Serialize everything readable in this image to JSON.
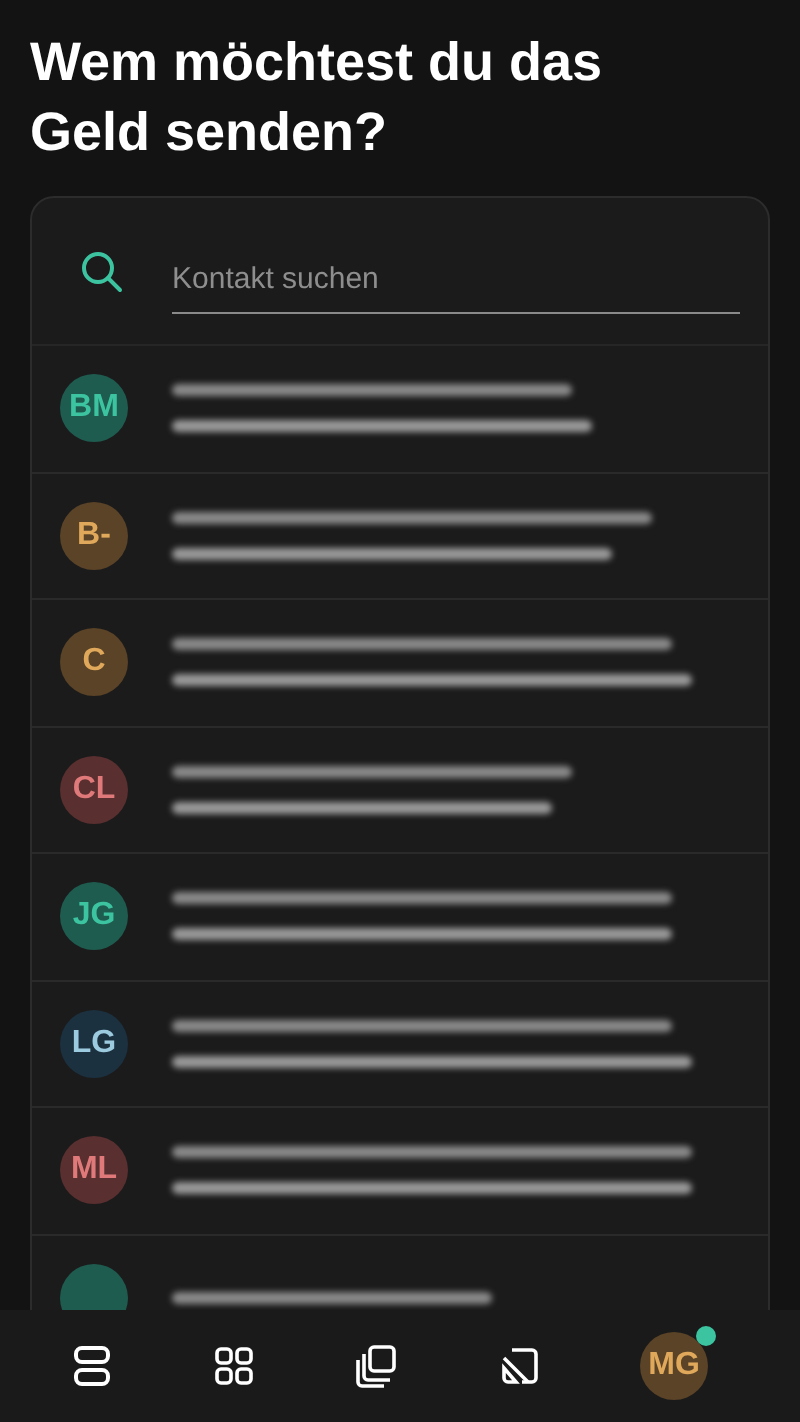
{
  "title": "Wem möchtest du das Geld senden?",
  "search": {
    "placeholder": "Kontakt suchen"
  },
  "contacts": [
    {
      "initials": "BM",
      "color": "#1f5c50"
    },
    {
      "initials": "B-",
      "color": "#5a4327"
    },
    {
      "initials": "C",
      "color": "#5a4327"
    },
    {
      "initials": "CL",
      "color": "#5a2f30"
    },
    {
      "initials": "JG",
      "color": "#1f5c50"
    },
    {
      "initials": "LG",
      "color": "#1c3140"
    },
    {
      "initials": "ML",
      "color": "#5a2f30"
    },
    {
      "color": "#1f5c50"
    }
  ],
  "bottom_nav": [
    {
      "kind": "list"
    },
    {
      "kind": "grid"
    },
    {
      "kind": "stack"
    },
    {
      "kind": "cast"
    },
    {
      "kind": "profile",
      "initials": "MG",
      "notification": true
    }
  ]
}
